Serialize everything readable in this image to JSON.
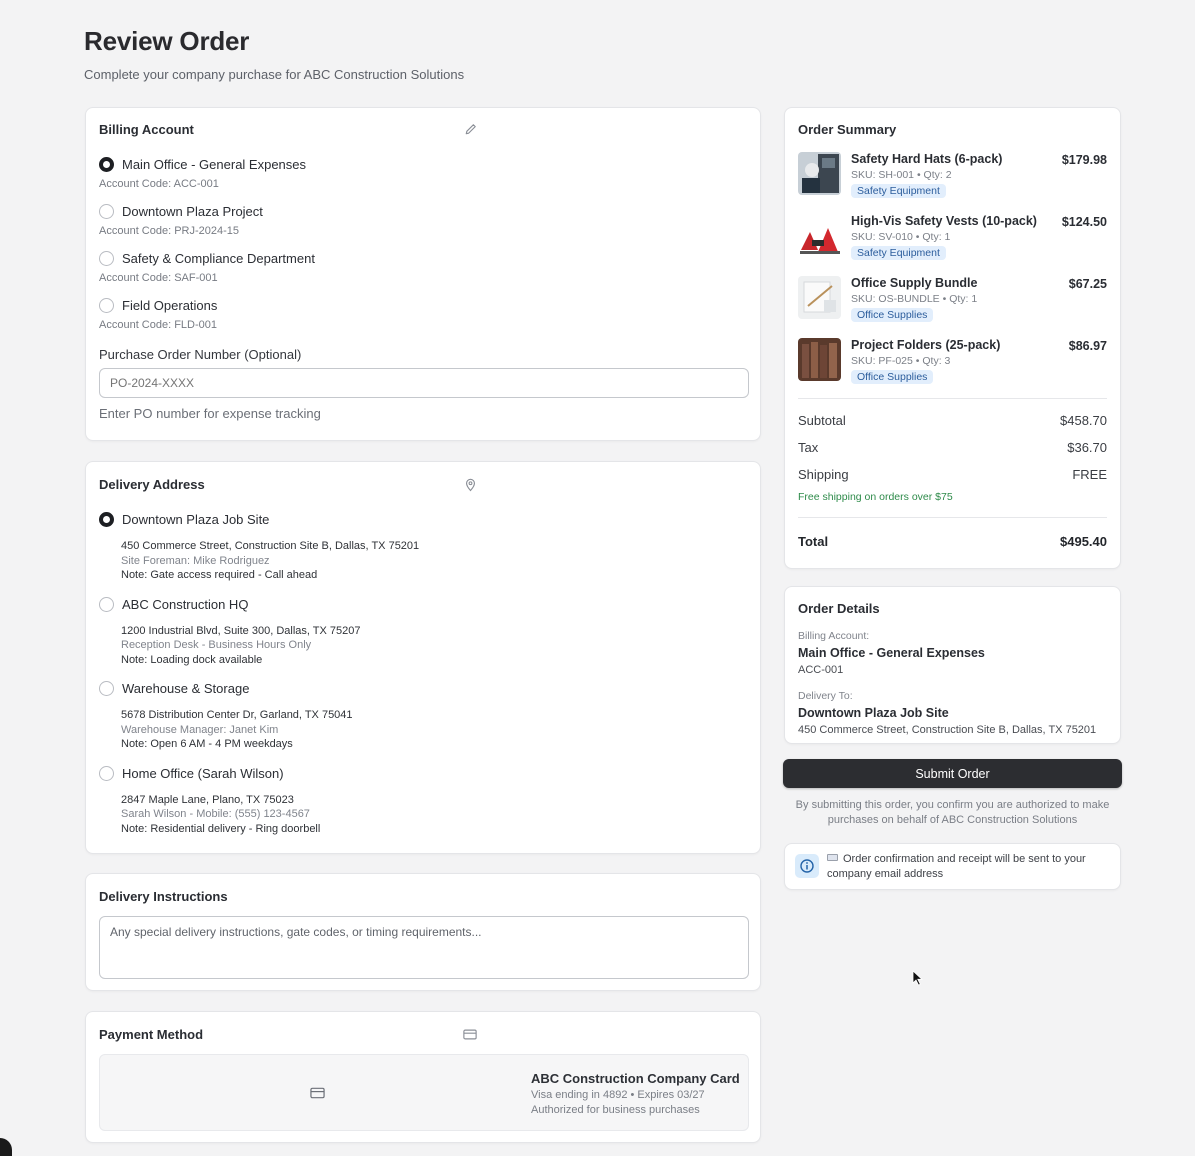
{
  "page": {
    "title": "Review Order",
    "subtitle": "Complete your company purchase for ABC Construction Solutions"
  },
  "billing": {
    "title": "Billing Account",
    "icon": "pencil-icon",
    "options": [
      {
        "label": "Main Office - General Expenses",
        "code": "Account Code: ACC-001",
        "selected": true
      },
      {
        "label": "Downtown Plaza Project",
        "code": "Account Code: PRJ-2024-15",
        "selected": false
      },
      {
        "label": "Safety & Compliance Department",
        "code": "Account Code: SAF-001",
        "selected": false
      },
      {
        "label": "Field Operations",
        "code": "Account Code: FLD-001",
        "selected": false
      }
    ],
    "po_label": "Purchase Order Number (Optional)",
    "po_placeholder": "PO-2024-XXXX",
    "po_help": "Enter PO number for expense tracking"
  },
  "delivery": {
    "title": "Delivery Address",
    "icon": "map-pin-icon",
    "options": [
      {
        "label": "Downtown Plaza Job Site",
        "address": "450 Commerce Street, Construction Site B, Dallas, TX 75201",
        "contact": "Site Foreman: Mike Rodriguez",
        "note": "Note: Gate access required - Call ahead",
        "selected": true
      },
      {
        "label": "ABC Construction HQ",
        "address": "1200 Industrial Blvd, Suite 300, Dallas, TX 75207",
        "contact": "Reception Desk - Business Hours Only",
        "note": "Note: Loading dock available",
        "selected": false
      },
      {
        "label": "Warehouse & Storage",
        "address": "5678 Distribution Center Dr, Garland, TX 75041",
        "contact": "Warehouse Manager: Janet Kim",
        "note": "Note: Open 6 AM - 4 PM weekdays",
        "selected": false
      },
      {
        "label": "Home Office (Sarah Wilson)",
        "address": "2847 Maple Lane, Plano, TX 75023",
        "contact": "Sarah Wilson - Mobile: (555) 123-4567",
        "note": "Note: Residential delivery - Ring doorbell",
        "selected": false
      }
    ]
  },
  "instructions": {
    "title": "Delivery Instructions",
    "placeholder": "Any special delivery instructions, gate codes, or timing requirements..."
  },
  "payment": {
    "title": "Payment Method",
    "icon": "credit-card-icon",
    "card_name": "ABC Construction Company Card",
    "card_detail": "Visa ending in 4892 • Expires 03/27",
    "card_note": "Authorized for business purchases"
  },
  "summary": {
    "title": "Order Summary",
    "items": [
      {
        "name": "Safety Hard Hats (6-pack)",
        "sku": "SKU: SH-001 • Qty: 2",
        "category": "Safety Equipment",
        "price": "$179.98"
      },
      {
        "name": "High-Vis Safety Vests (10-pack)",
        "sku": "SKU: SV-010 • Qty: 1",
        "category": "Safety Equipment",
        "price": "$124.50"
      },
      {
        "name": "Office Supply Bundle",
        "sku": "SKU: OS-BUNDLE • Qty: 1",
        "category": "Office Supplies",
        "price": "$67.25"
      },
      {
        "name": "Project Folders (25-pack)",
        "sku": "SKU: PF-025 • Qty: 3",
        "category": "Office Supplies",
        "price": "$86.97"
      }
    ],
    "subtotal_label": "Subtotal",
    "subtotal": "$458.70",
    "tax_label": "Tax",
    "tax": "$36.70",
    "shipping_label": "Shipping",
    "shipping": "FREE",
    "free_note": "Free shipping on orders over $75",
    "total_label": "Total",
    "total": "$495.40"
  },
  "details": {
    "title": "Order Details",
    "billing_label": "Billing Account:",
    "billing_value": "Main Office - General Expenses",
    "billing_code": "ACC-001",
    "delivery_label": "Delivery To:",
    "delivery_value": "Downtown Plaza Job Site",
    "delivery_address": "450 Commerce Street, Construction Site B, Dallas, TX 75201"
  },
  "submit": {
    "label": "Submit Order",
    "note": "By submitting this order, you confirm you are authorized to make purchases on behalf of ABC Construction Solutions"
  },
  "notice": {
    "text": "Order confirmation and receipt will be sent to your company email address"
  },
  "colors": {
    "background": "#f3f3f4",
    "button": "#2c2d31",
    "badge_bg": "#e2eefc",
    "badge_text": "#2c5d9c",
    "free_green": "#2e8b4a"
  }
}
